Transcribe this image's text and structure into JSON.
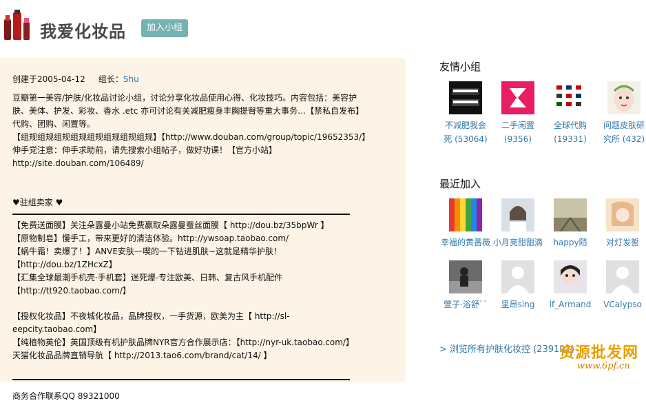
{
  "header": {
    "title": "我爱化妆品",
    "join_label": "加入小组"
  },
  "intro": {
    "created_label": "创建于2005-04-12",
    "leader_prefix": "组长：",
    "leader_name": "Shu",
    "lines": [
      "豆瓣第一美容/护肤/化妆品讨论小组，讨论分享化妆品使用心得、化妆技巧。内容包括：美容护肤、美体、护发、彩妆、香水 .etc 亦可讨论有关减肥瘦身丰胸提臀等重大事务…【禁私自发布】代购、团购、闲置等。",
      "【组规组规组规组规组规组规组规组规】【http://www.douban.com/group/topic/19652353/】",
      "伸手党注意：伸手求助前，请先搜索小组帖子，做好功课！【官方小站】http://site.douban.com/106489/"
    ],
    "sellers_heading": "♥驻组卖家 ♥",
    "sellers": [
      "【免费送面膜】关注朵露曼小站免费赢取朵露曼蚕丝面膜【 http://dou.bz/35bpWr 】",
      "【原物制皂】慢手工，带来更好的清洁体验。http://ywsoap.taobao.com/",
      "【蜗牛霜！卖爆了！】ANVE安肤一喫的一下钻进肌肤~这就是精华护肤！【http://dou.bz/1ZHcxZ】",
      "【汇集全球最潮手机壳·手机套】迷死爆-专注欧美、日韩、复古风手机配件【http://tt920.taobao.com/】"
    ],
    "brands": [
      "【授权化妆品】不夜城化妆品，品牌授权，一手货源，欧美为主【 http://sl-eepcity.taobao.com】",
      "【纯植物英伦】英国顶级有机护肤品牌NYR官方合作展示店：【http://nyr-uk.taobao.com/】",
      "天猫化妆品品牌直销导航【 http://2013.tao6.com/brand/cat/14/ 】"
    ],
    "contact": "商务合作联系QQ 89321000"
  },
  "sidebar": {
    "friends_title": "友情小组",
    "friends": [
      {
        "name": "不减肥我会死",
        "count": "(53064)",
        "line1": "不减肥我会",
        "line2": "死 (53064)"
      },
      {
        "name": "二手闲置",
        "count": "(9356)",
        "line1": "二手闲置",
        "line2": "(9356)"
      },
      {
        "name": "全球代购",
        "count": "(19331)",
        "line1": "全球代购",
        "line2": "(19331)"
      },
      {
        "name": "问题皮肤研究所",
        "count": "(432)",
        "line1": "问题皮肤研",
        "line2": "究所 (432)"
      }
    ],
    "recent_title": "最近加入",
    "recent": [
      {
        "name": "幸福的黄蔷薇"
      },
      {
        "name": "小月亮甜甜滴"
      },
      {
        "name": "happy陌"
      },
      {
        "name": "对灯发誓"
      },
      {
        "name": "萱子·浴舒``"
      },
      {
        "name": "里昂sing"
      },
      {
        "name": "lf_Armand"
      },
      {
        "name": "VCalypso"
      }
    ],
    "more_link": "> 浏览所有护肤化妆控 (239191)"
  },
  "watermark": {
    "cn": "资源批发网",
    "url": "www.6pf.cn"
  }
}
